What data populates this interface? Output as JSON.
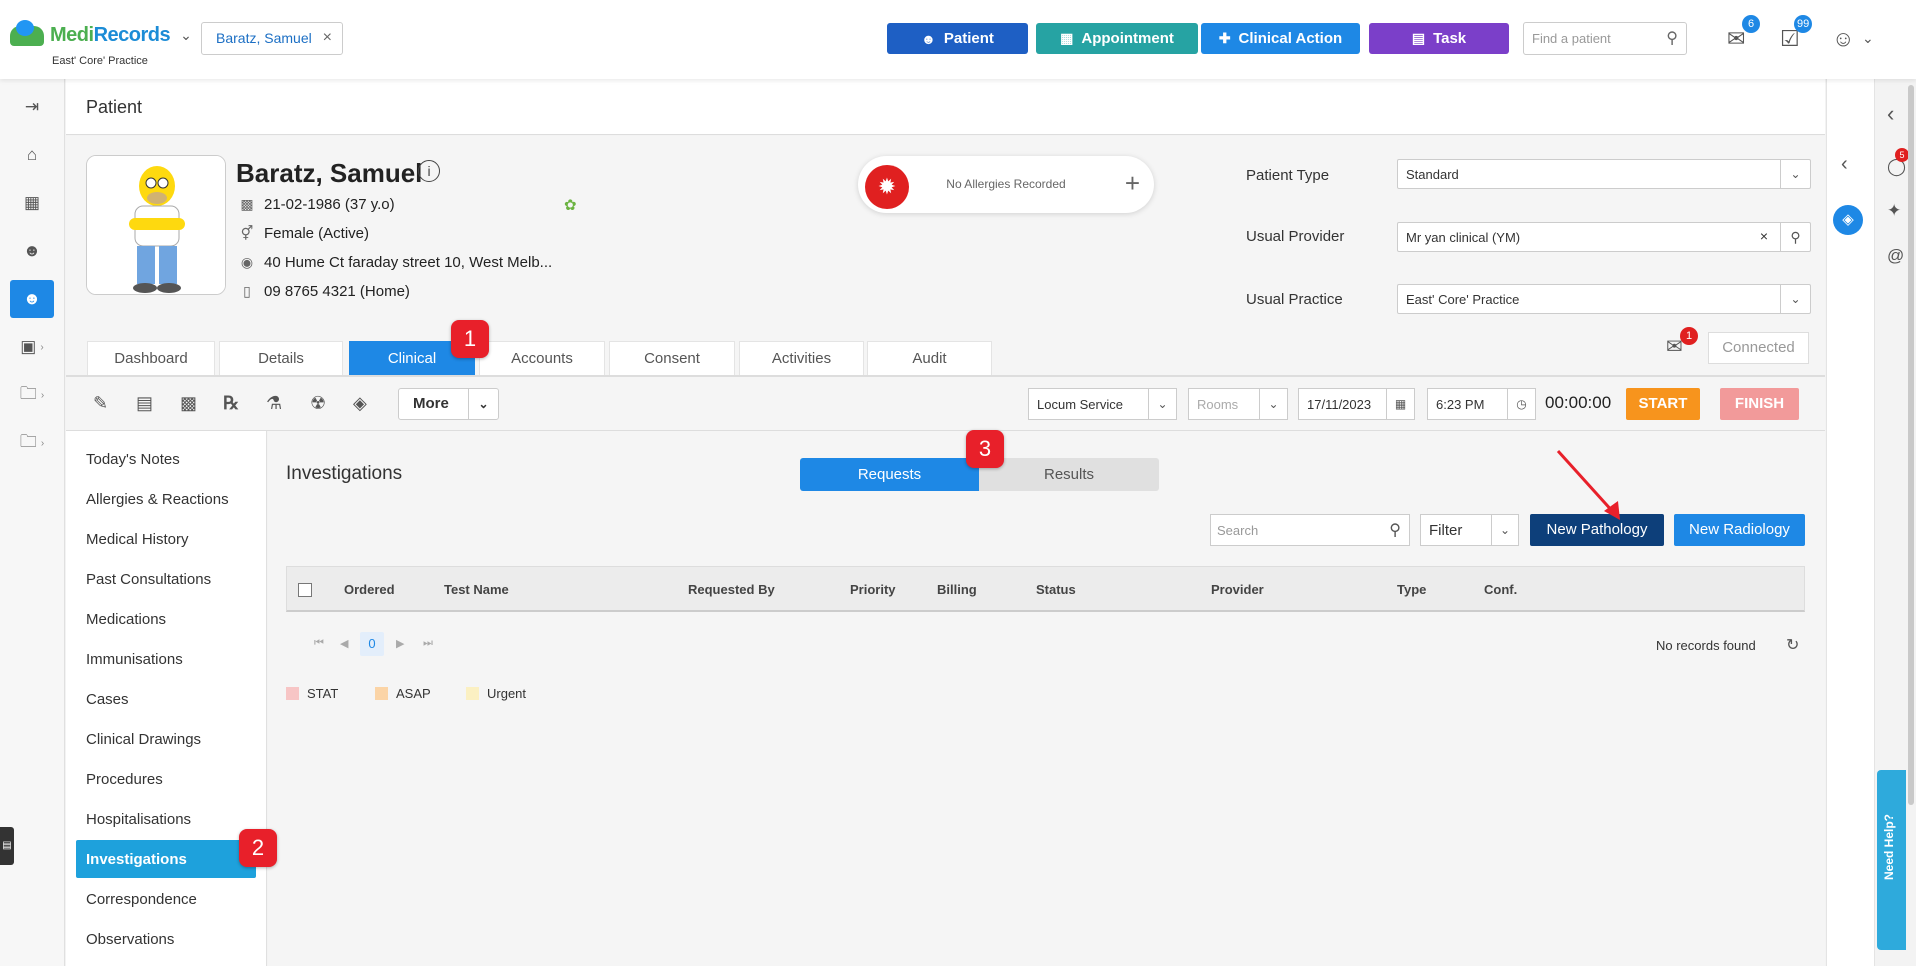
{
  "app": {
    "brand_a": "Medi",
    "brand_b": "Records",
    "practice": "East' Core' Practice"
  },
  "open_patient_chip": "Baratz, Samuel",
  "top_buttons": {
    "patient": "Patient",
    "appointment": "Appointment",
    "clinical_action": "Clinical Action",
    "task": "Task"
  },
  "find_patient_placeholder": "Find a patient",
  "badges": {
    "messages": "6",
    "tasks": "99"
  },
  "page_title": "Patient",
  "patient": {
    "name": "Baratz, Samuel",
    "dob": "21-02-1986 (37 y.o)",
    "gender": "Female (Active)",
    "address": "40 Hume Ct faraday street 10, West Melb...",
    "phone": "09 8765 4321 (Home)",
    "allergies": "No Allergies Recorded"
  },
  "fields": {
    "patient_type_label": "Patient Type",
    "patient_type_value": "Standard",
    "usual_provider_label": "Usual Provider",
    "usual_provider_value": "Mr yan clinical (YM)",
    "usual_practice_label": "Usual Practice",
    "usual_practice_value": "East' Core' Practice"
  },
  "tabs": [
    "Dashboard",
    "Details",
    "Clinical",
    "Accounts",
    "Consent",
    "Activities",
    "Audit"
  ],
  "active_tab": "Clinical",
  "inbox_badge": "1",
  "connected_label": "Connected",
  "toolbar": {
    "more": "More",
    "service": "Locum Service",
    "rooms": "Rooms",
    "date": "17/11/2023",
    "time": "6:23 PM",
    "timer": "00:00:00",
    "start": "START",
    "finish": "FINISH"
  },
  "side_menu": [
    "Today's Notes",
    "Allergies & Reactions",
    "Medical History",
    "Past Consultations",
    "Medications",
    "Immunisations",
    "Cases",
    "Clinical Drawings",
    "Procedures",
    "Hospitalisations",
    "Investigations",
    "Correspondence",
    "Observations"
  ],
  "active_side": "Investigations",
  "investigations": {
    "title": "Investigations",
    "seg_requests": "Requests",
    "seg_results": "Results",
    "search_placeholder": "Search",
    "filter": "Filter",
    "new_pathology": "New Pathology",
    "new_radiology": "New Radiology",
    "columns": [
      "Ordered",
      "Test Name",
      "Requested By",
      "Priority",
      "Billing",
      "Status",
      "Provider",
      "Type",
      "Conf."
    ],
    "page": "0",
    "no_records": "No records found",
    "legend": [
      "STAT",
      "ASAP",
      "Urgent"
    ]
  },
  "legend_colors": [
    "#f7c5c5",
    "#fbd4a6",
    "#fbf0c2"
  ],
  "help_label": "Need Help?",
  "chat_badge": "5",
  "callouts": [
    "1",
    "2",
    "3"
  ],
  "colors": {
    "primary": "#1e88e5",
    "teal": "#26a3a3",
    "purple": "#7b3fc9",
    "navy": "#0d3f7a",
    "orange": "#f7941d",
    "red": "#e8202a"
  }
}
